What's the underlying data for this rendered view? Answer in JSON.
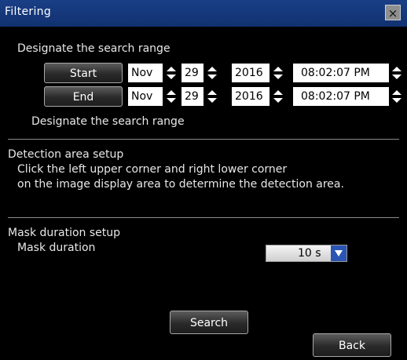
{
  "window": {
    "title": "Filtering",
    "close_glyph": "×"
  },
  "search_range": {
    "heading": "Designate the search range",
    "start": {
      "label": "Start",
      "month": "Nov",
      "day": "29",
      "year": "2016",
      "time": "08:02:07 PM"
    },
    "end": {
      "label": "End",
      "month": "Nov",
      "day": "29",
      "year": "2016",
      "time": "08:02:07 PM"
    },
    "note": "Designate the search range"
  },
  "detection": {
    "heading": "Detection area setup",
    "line1": "Click the left upper corner and right lower corner",
    "line2": "on the image display area to determine the detection area."
  },
  "mask": {
    "heading": "Mask duration setup",
    "label": "Mask duration",
    "value": "10 s"
  },
  "buttons": {
    "search": "Search",
    "back": "Back"
  },
  "colors": {
    "titlebar": "#113170",
    "dropdown_accent": "#2a55b3"
  },
  "icons": {
    "spin": "up-down-arrows",
    "dropdown": "triangle-down",
    "close": "x-mark"
  }
}
